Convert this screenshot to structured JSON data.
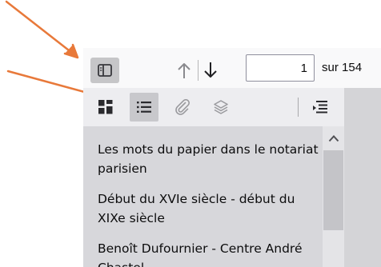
{
  "toolbar": {
    "page_value": "1",
    "page_count": "sur 154"
  },
  "outline": {
    "items": [
      {
        "label": "Les mots du papier dans le notariat parisien"
      },
      {
        "label": "Début du XVIe siècle - début du XIXe siècle"
      },
      {
        "label": "Benoît Dufournier - Centre André Chastel"
      }
    ]
  },
  "colors": {
    "annotation_arrow": "#e8793a",
    "icon": "#38383d"
  },
  "icons": {
    "sidebar_toggle": "sidebar-toggle-icon",
    "previous_page": "arrow-up-icon",
    "next_page": "arrow-down-icon",
    "thumbnails": "thumbnails-grid-icon",
    "outline": "document-outline-icon",
    "attachments": "paperclip-icon",
    "layers": "layers-icon",
    "current_outline_item": "current-outline-item-icon"
  }
}
